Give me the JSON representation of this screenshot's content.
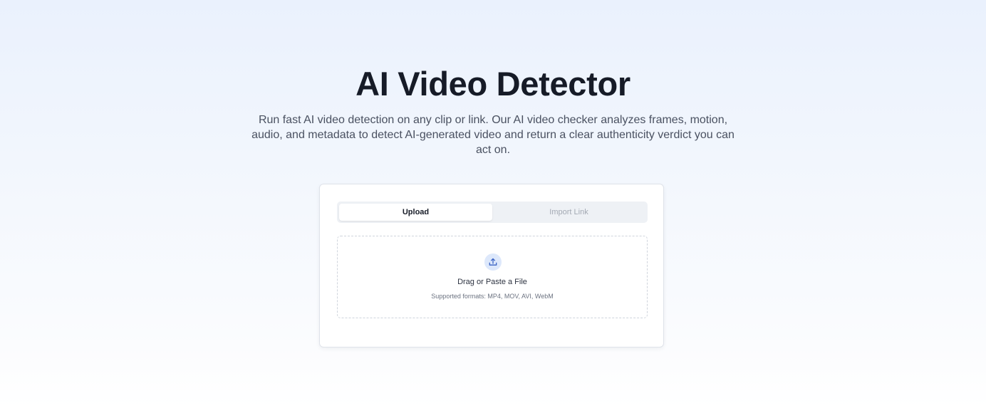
{
  "hero": {
    "title": "AI Video Detector",
    "description": "Run fast AI video detection on any clip or link. Our AI video checker analyzes frames, motion, audio, and metadata to detect AI-generated video and return a clear authenticity verdict you can act on."
  },
  "detector": {
    "tabs": [
      {
        "label": "Upload",
        "active": true
      },
      {
        "label": "Import Link",
        "active": false
      }
    ],
    "dropzone": {
      "icon": "upload-icon",
      "title": "Drag or Paste a File",
      "formats": "Supported formats: MP4, MOV, AVI, WebM"
    }
  },
  "colors": {
    "accent": "#3b63c4",
    "icon_bg": "#dde8fb",
    "title": "#161b27"
  }
}
